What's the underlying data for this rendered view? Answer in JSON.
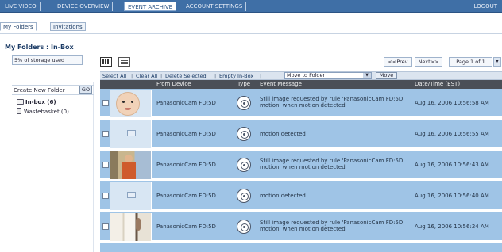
{
  "top_nav": {
    "tabs": [
      "LIVE VIDEO",
      "DEVICE OVERVIEW",
      "EVENT ARCHIVE",
      "ACCOUNT SETTINGS"
    ],
    "active_index": 2,
    "logout": "LOGOUT"
  },
  "sub_tabs": {
    "my_folders": "My Folders",
    "invitations": "Invitations"
  },
  "section_title": "My Folders : In-Box",
  "storage_used": "5% of storage used",
  "left_panel": {
    "create_folder_label": "Create New Folder",
    "go_button": "GO",
    "folders": [
      {
        "name": "In-box (6)",
        "icon": "inbox-folder-icon"
      },
      {
        "name": "Wastebasket (0)",
        "icon": "wastebasket-icon"
      }
    ]
  },
  "pager": {
    "prev": "<<Prev",
    "next": "Next>>",
    "page_label": "Page 1 of 1"
  },
  "actions": {
    "select_all": "Select All",
    "clear_all": "Clear All",
    "delete_selected": "Delete Selected",
    "empty_inbox": "Empty In-Box",
    "move_to_folder": "Move to Folder",
    "move_button": "Move"
  },
  "table": {
    "headers": {
      "from_device": "From Device",
      "type": "Type",
      "event_message": "Event Message",
      "datetime": "Date/Time (EST)"
    },
    "rows": [
      {
        "thumb": "baby",
        "device": "PanasonicCam FD:5D",
        "message": "Still image requested by rule 'PanasonicCam FD:5D motion' when motion detected",
        "datetime": "Aug 16, 2006 10:56:58 AM"
      },
      {
        "thumb": "blank",
        "device": "PanasonicCam FD:5D",
        "message": "motion detected",
        "datetime": "Aug 16, 2006 10:56:55 AM"
      },
      {
        "thumb": "person",
        "device": "PanasonicCam FD:5D",
        "message": "Still image requested by rule 'PanasonicCam FD:5D motion' when motion detected",
        "datetime": "Aug 16, 2006 10:56:43 AM"
      },
      {
        "thumb": "blank",
        "device": "PanasonicCam FD:5D",
        "message": "motion detected",
        "datetime": "Aug 16, 2006 10:56:40 AM"
      },
      {
        "thumb": "door",
        "device": "PanasonicCam FD:5D",
        "message": "Still image requested by rule 'PanasonicCam FD:5D motion' when motion detected",
        "datetime": "Aug 16, 2006 10:56:24 AM"
      }
    ]
  },
  "colors": {
    "nav_blue": "#3f6fa6",
    "row_blue": "#9fc4e6",
    "header_dark": "#4b4f57"
  }
}
